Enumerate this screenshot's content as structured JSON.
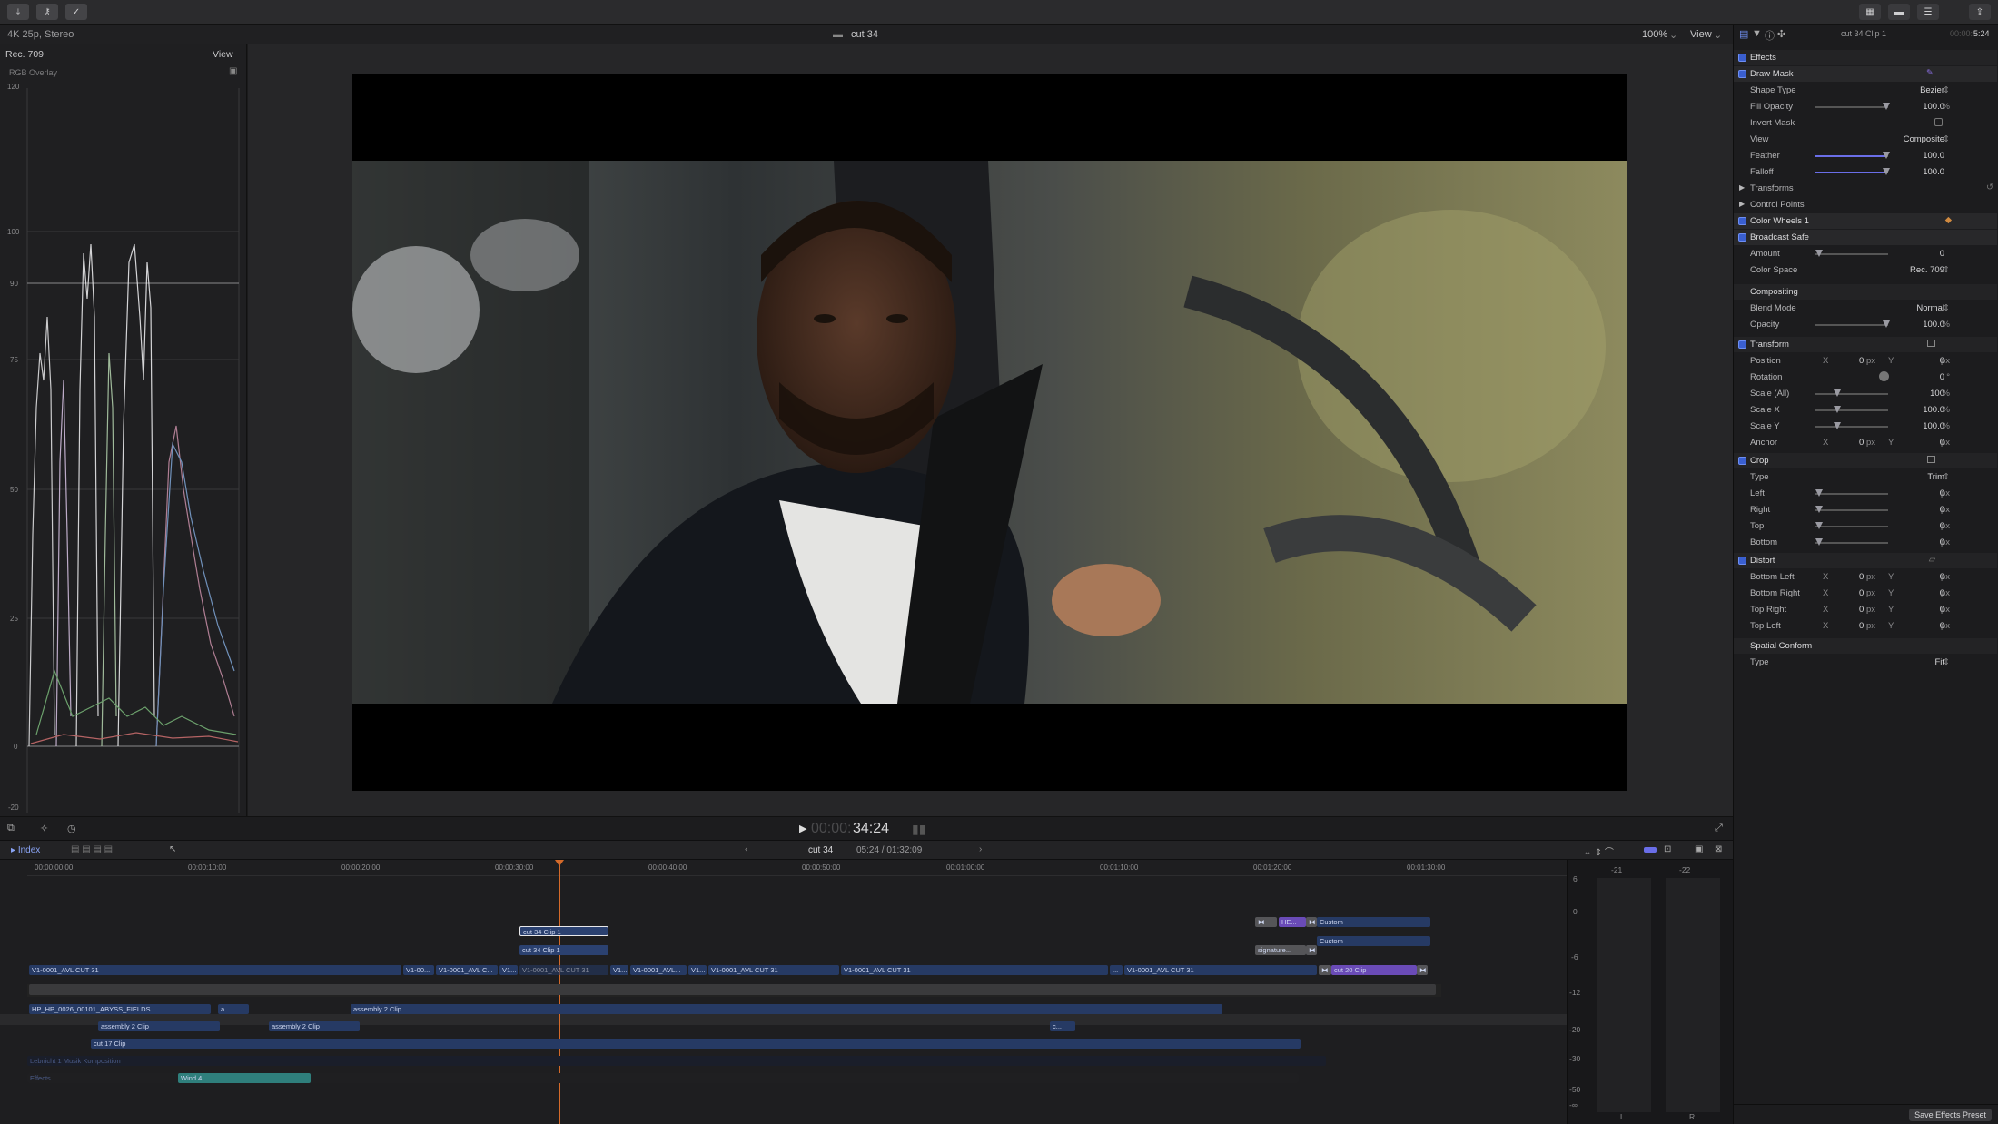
{
  "toolbar": {
    "left_icons": [
      "import-icon",
      "keyword-icon",
      "checkmark-icon"
    ],
    "right_icons": [
      "browser-layout-icon",
      "timeline-layout-icon",
      "inspector-layout-icon",
      "share-icon"
    ]
  },
  "infobar": {
    "format": "4K 25p, Stereo",
    "project_title": "cut 34",
    "zoom": "100%",
    "view_label": "View"
  },
  "scope": {
    "color_space": "Rec. 709",
    "view_label": "View",
    "mode": "RGB Overlay",
    "scale": [
      "120",
      "100",
      "90",
      "75",
      "50",
      "25",
      "0",
      "-20"
    ]
  },
  "inspector": {
    "clip_name": "cut 34 Clip 1",
    "duration": "5:24",
    "duration_prefix": "00:00:0",
    "effects_header": "Effects",
    "rows": {
      "draw_mask": "Draw Mask",
      "shape_type_label": "Shape Type",
      "shape_type": "Bezier",
      "fill_opacity_label": "Fill Opacity",
      "fill_opacity": "100.0",
      "invert_mask_label": "Invert Mask",
      "view_label": "View",
      "view": "Composite",
      "feather_label": "Feather",
      "feather": "100.0",
      "falloff_label": "Falloff",
      "falloff": "100.0",
      "transforms": "Transforms",
      "control_points": "Control Points",
      "color_wheels": "Color Wheels 1",
      "broadcast_safe": "Broadcast Safe",
      "amount_label": "Amount",
      "amount": "0",
      "color_space_label": "Color Space",
      "color_space": "Rec. 709",
      "compositing": "Compositing",
      "blend_mode_label": "Blend Mode",
      "blend_mode": "Normal",
      "opacity_label": "Opacity",
      "opacity": "100.0",
      "transform": "Transform",
      "position_label": "Position",
      "position_x": "0",
      "position_y": "0",
      "rotation_label": "Rotation",
      "rotation": "0",
      "scale_all_label": "Scale (All)",
      "scale_all": "100",
      "scale_x_label": "Scale X",
      "scale_x": "100.0",
      "scale_y_label": "Scale Y",
      "scale_y": "100.0",
      "anchor_label": "Anchor",
      "anchor_x": "0",
      "anchor_y": "0",
      "crop": "Crop",
      "crop_type_label": "Type",
      "crop_type": "Trim",
      "left_label": "Left",
      "left": "0",
      "right_label": "Right",
      "right": "0",
      "top_label": "Top",
      "top": "0",
      "bottom_label": "Bottom",
      "bottom": "0",
      "distort": "Distort",
      "bottom_left_label": "Bottom Left",
      "bl_x": "0",
      "bl_y": "0",
      "bottom_right_label": "Bottom Right",
      "br_x": "0",
      "br_y": "0",
      "top_right_label": "Top Right",
      "tr_x": "0",
      "tr_y": "0",
      "top_left_label": "Top Left",
      "tl_x": "0",
      "tl_y": "0",
      "spatial_conform": "Spatial Conform",
      "sc_type_label": "Type",
      "sc_type": "Fit"
    },
    "units": {
      "percent": "%",
      "px": "px",
      "deg": "°",
      "x": "X",
      "y": "Y"
    },
    "save_preset": "Save Effects Preset"
  },
  "transport": {
    "timecode_dim": "00:00:",
    "timecode": "34:24"
  },
  "timeline_header": {
    "index_label": "Index",
    "project_name": "cut 34",
    "position": "05:24 / 01:32:09"
  },
  "ruler": [
    "00:00:00:00",
    "00:00:10:00",
    "00:00:20:00",
    "00:00:30:00",
    "00:00:40:00",
    "00:00:50:00",
    "00:01:00:00",
    "00:01:10:00",
    "00:01:20:00",
    "00:01:30:00"
  ],
  "clips": {
    "conn1": "cut 34 Clip 1",
    "conn2": "cut 34 Clip 1",
    "he": "HE...",
    "custom1": "Custom",
    "signature": "signature...",
    "custom2": "Custom",
    "pl1": "V1-0001_AVL CUT 31",
    "pl2": "V1-00...",
    "pl3": "V1-0001_AVL C...",
    "pl4": "V1...",
    "pl5": "V1-0001_AVL CUT 31",
    "pl6": "V1...",
    "pl7": "V1-0001_AVL...",
    "pl8": "V1...",
    "pl9": "V1-0001_AVL CUT 31",
    "pl10": "V1-0001_AVL CUT 31",
    "pl11": "...",
    "pl12": "V1-0001_AVL CUT 31",
    "cut20": "cut 20 Clip",
    "a1": "HP_HP_0026_00101_ABYSS_FIELDS...",
    "a2": "a...",
    "a3": "assembly 2 Clip",
    "a4": "assembly 2 Clip",
    "a5": "assembly 2 Clip",
    "a6": "c...",
    "a7": "cut 17 Clip",
    "music": "Lebnicht 1 Musik Komposition",
    "effects": "Effects",
    "wind": "Wind 4"
  },
  "meters": {
    "peak_l": "-21",
    "peak_r": "-22",
    "scale": [
      "6",
      "0",
      "-6",
      "-12",
      "-20",
      "-30",
      "-50",
      "-∞"
    ],
    "channel_l": "L",
    "channel_r": "R"
  }
}
